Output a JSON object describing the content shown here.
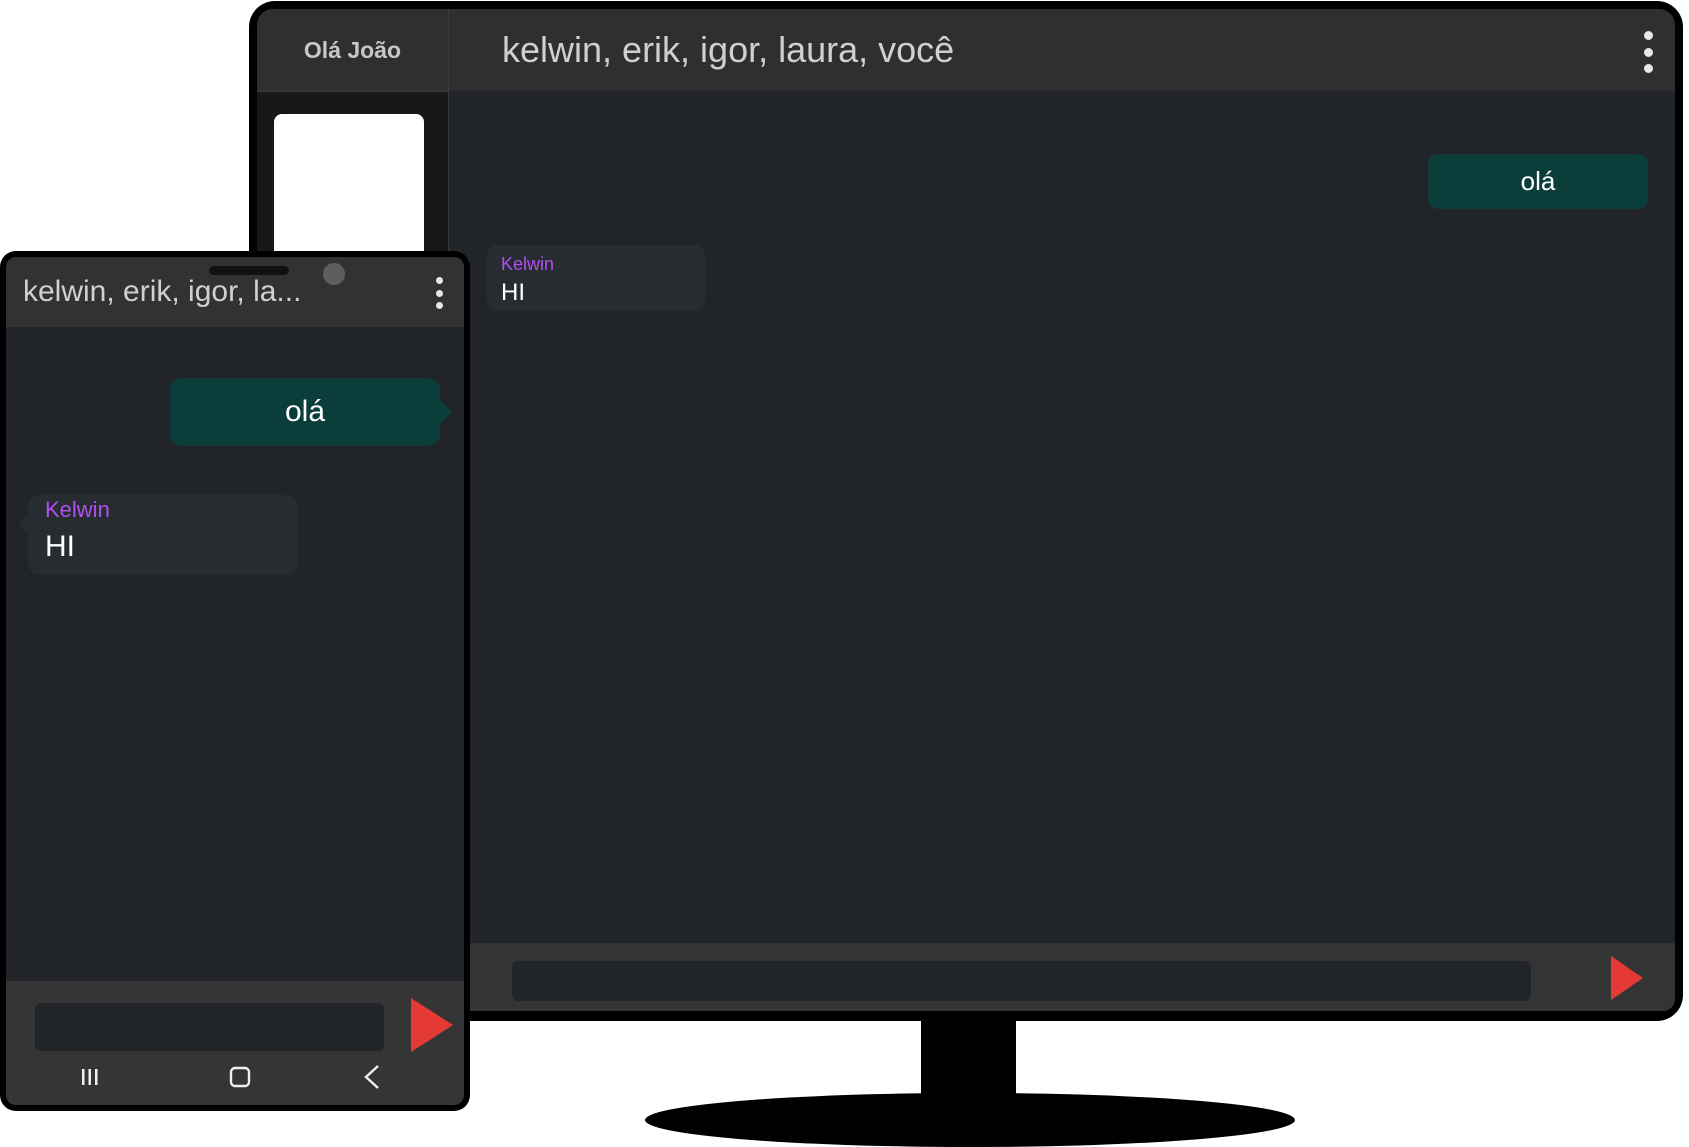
{
  "desktop": {
    "sidebar_greeting": "Olá João",
    "chat_title": "kelwin, erik, igor, laura, você",
    "messages": [
      {
        "direction": "outgoing",
        "text": "olá"
      },
      {
        "direction": "incoming",
        "sender": "Kelwin",
        "text": "HI"
      }
    ],
    "input_placeholder": "",
    "send_icon": "send-icon"
  },
  "mobile": {
    "chat_title": "kelwin, erik, igor, la...",
    "messages": [
      {
        "direction": "outgoing",
        "text": "olá"
      },
      {
        "direction": "incoming",
        "sender": "Kelwin",
        "text": "HI"
      }
    ],
    "input_placeholder": "",
    "nav_icons": [
      "recents-icon",
      "home-icon",
      "back-icon"
    ]
  },
  "colors": {
    "accent_send": "#e53935",
    "outgoing_bubble": "#0b3d3a",
    "sender_name": "#b14ef0",
    "chat_background": "#212529",
    "header_background": "#2f2f2f"
  }
}
